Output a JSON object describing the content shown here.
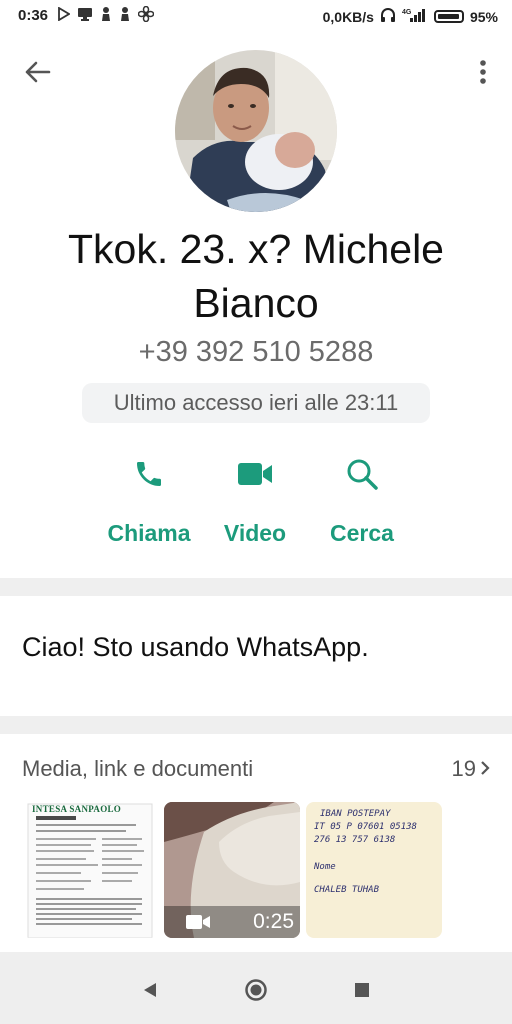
{
  "status_bar": {
    "time": "0:36",
    "net_speed": "0,0KB/s",
    "battery": "95%",
    "icons_left": [
      "play-store-icon",
      "monitor-icon",
      "person-icon",
      "person-icon",
      "fan-icon"
    ],
    "icons_right": [
      "headphones-icon",
      "signal-4g-icon",
      "battery-icon"
    ]
  },
  "header": {
    "back_icon": "arrow-left-icon",
    "menu_icon": "more-vertical-icon"
  },
  "contact": {
    "name": "Tkok. 23. x? Michele Bianco",
    "phone": "+39 392 510 5288",
    "last_seen": "Ultimo accesso ieri alle 23:11"
  },
  "actions": [
    {
      "label": "Chiama",
      "icon": "phone-icon"
    },
    {
      "label": "Video",
      "icon": "video-icon"
    },
    {
      "label": "Cerca",
      "icon": "search-icon"
    }
  ],
  "about": {
    "text": "Ciao! Sto usando WhatsApp."
  },
  "media": {
    "title": "Media, link e documenti",
    "count": "19",
    "items": [
      {
        "type": "document",
        "brand": "INTESA SANPAOLO"
      },
      {
        "type": "video",
        "duration": "0:25"
      },
      {
        "type": "image",
        "lines": [
          "IBAN POSTEPAY",
          "IT 05 P 07601 05138",
          "276 13 757 6138",
          "Nome",
          "CHALEB TUHAB"
        ]
      }
    ]
  },
  "colors": {
    "accent": "#1c9b7c",
    "background": "#efefef"
  }
}
